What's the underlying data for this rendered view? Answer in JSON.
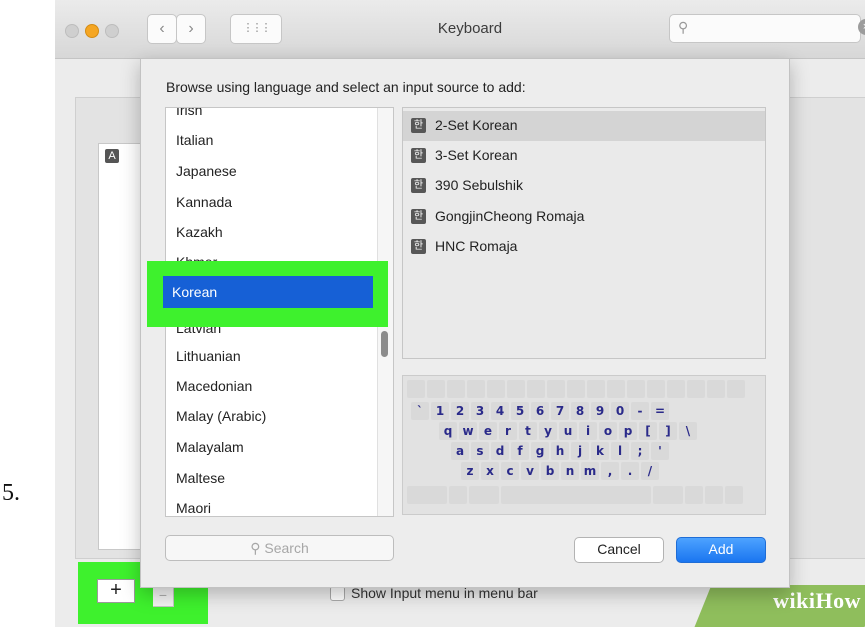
{
  "step_number": "5.",
  "window": {
    "title": "Keyboard",
    "grid_icon": "⋮⋮⋮",
    "back_icon": "‹",
    "forward_icon": "›",
    "search_value": ""
  },
  "background": {
    "list_badge": "A",
    "plus_label": "+",
    "minus_label": "−",
    "show_input_menu_label": "Show Input menu in menu bar",
    "watermark": "wikiHow"
  },
  "sheet": {
    "prompt": "Browse using language and select an input source to add:",
    "languages": [
      "Irish",
      "Italian",
      "Japanese",
      "Kannada",
      "Kazakh",
      "Khmer",
      "Korean",
      "Latvian",
      "Lithuanian",
      "Macedonian",
      "Malay (Arabic)",
      "Malayalam",
      "Maltese",
      "Maori"
    ],
    "selected_language": "Korean",
    "input_sources": [
      {
        "icon": "한",
        "label": "2-Set Korean",
        "selected": true
      },
      {
        "icon": "한",
        "label": "3-Set Korean",
        "selected": false
      },
      {
        "icon": "한",
        "label": "390 Sebulshik",
        "selected": false
      },
      {
        "icon": "한",
        "label": "GongjinCheong Romaja",
        "selected": false
      },
      {
        "icon": "한",
        "label": "HNC Romaja",
        "selected": false
      }
    ],
    "keyboard_rows": [
      [
        "`",
        "1",
        "2",
        "3",
        "4",
        "5",
        "6",
        "7",
        "8",
        "9",
        "0",
        "-",
        "="
      ],
      [
        "q",
        "w",
        "e",
        "r",
        "t",
        "y",
        "u",
        "i",
        "o",
        "p",
        "[",
        "]",
        "\\"
      ],
      [
        "a",
        "s",
        "d",
        "f",
        "g",
        "h",
        "j",
        "k",
        "l",
        ";",
        "'"
      ],
      [
        "z",
        "x",
        "c",
        "v",
        "b",
        "n",
        "m",
        ",",
        ".",
        "/"
      ]
    ],
    "search_placeholder": "Search",
    "cancel_label": "Cancel",
    "add_label": "Add"
  },
  "colors": {
    "highlight": "#3ef12d",
    "selection": "#1660d6",
    "accent_button": "#1a75f0"
  }
}
